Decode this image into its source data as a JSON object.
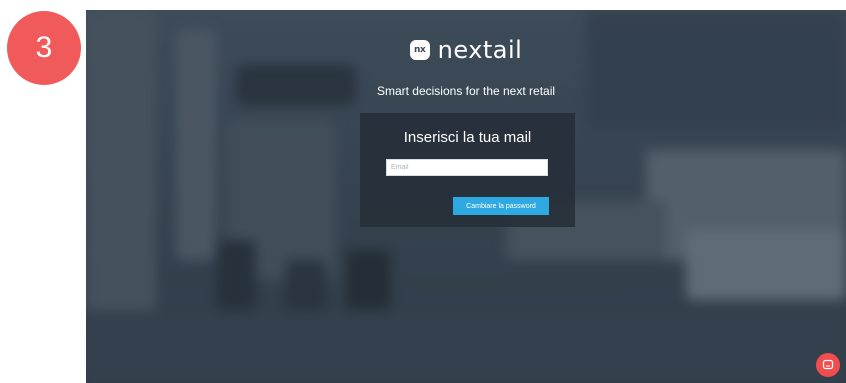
{
  "step_badge": {
    "number": "3"
  },
  "brand": {
    "logo_mark": "nx",
    "name": "nextail",
    "tagline": "Smart decisions for the next retail"
  },
  "form": {
    "title": "Inserisci la tua mail",
    "email_placeholder": "Email",
    "email_value": "",
    "submit_label": "Cambiare la password"
  },
  "icons": {
    "chat": "chat-bubble-icon"
  },
  "colors": {
    "accent": "#2ea9e2",
    "badge": "#f05a5a",
    "chat": "#f04e4e",
    "panel": "#262f38"
  }
}
